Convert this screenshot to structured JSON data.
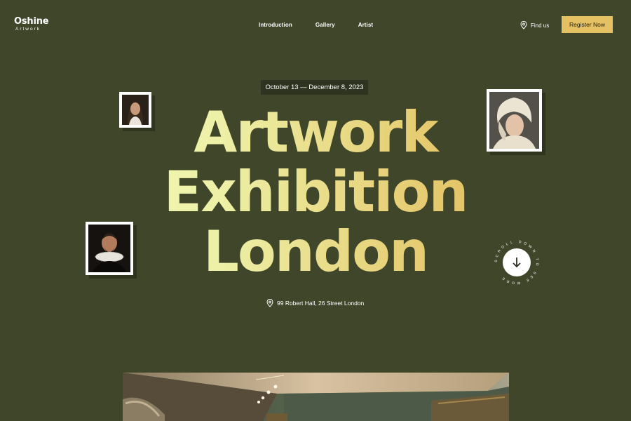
{
  "brand": {
    "name": "Oshine",
    "subtitle": "Artwork"
  },
  "nav": {
    "items": [
      "Introduction",
      "Gallery",
      "Artist"
    ]
  },
  "header": {
    "find_us": "Find us",
    "register_label": "Register Now"
  },
  "hero": {
    "date_range": "October 13 — December 8, 2023",
    "title_lines": [
      "Artwork",
      "Exhibition",
      "London"
    ],
    "address": "99 Robert Hall, 26 Street London",
    "scroll_text": "SCROLL DOWN TO SEE MORE"
  },
  "colors": {
    "background": "#3f462a",
    "accent": "#e6c163",
    "badge_bg": "#2f3420"
  },
  "icons": [
    "map-pin-icon",
    "arrow-down-icon"
  ]
}
